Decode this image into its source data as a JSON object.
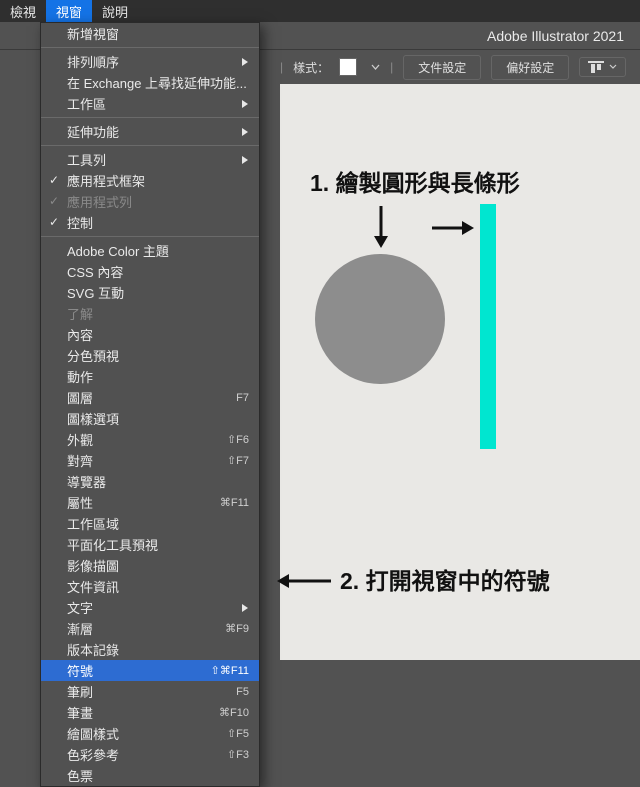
{
  "app_title": "Adobe Illustrator 2021",
  "menubar": {
    "items": [
      {
        "label": "檢視"
      },
      {
        "label": "視窗"
      },
      {
        "label": "說明"
      }
    ]
  },
  "controlbar": {
    "style_label": "樣式：",
    "file_setup": "文件設定",
    "pref_setup": "偏好設定"
  },
  "annotations": {
    "step1": "1.  繪製圓形與長條形",
    "step2": "2.  打開視窗中的符號"
  },
  "window_menu": [
    {
      "label": "新增視窗",
      "type": "item"
    },
    {
      "type": "sep"
    },
    {
      "label": "排列順序",
      "type": "sub"
    },
    {
      "label": "在 Exchange 上尋找延伸功能...",
      "type": "item"
    },
    {
      "label": "工作區",
      "type": "sub"
    },
    {
      "type": "sep"
    },
    {
      "label": "延伸功能",
      "type": "sub"
    },
    {
      "type": "sep"
    },
    {
      "label": "工具列",
      "type": "sub"
    },
    {
      "label": "應用程式框架",
      "type": "check",
      "checked": true
    },
    {
      "label": "應用程式列",
      "type": "check",
      "checked": true,
      "disabled": true
    },
    {
      "label": "控制",
      "type": "check",
      "checked": true
    },
    {
      "type": "sep"
    },
    {
      "label": "Adobe Color 主題",
      "type": "item"
    },
    {
      "label": "CSS 內容",
      "type": "item"
    },
    {
      "label": "SVG 互動",
      "type": "item"
    },
    {
      "label": "了解",
      "type": "item",
      "disabled": true
    },
    {
      "label": "內容",
      "type": "item"
    },
    {
      "label": "分色預視",
      "type": "item"
    },
    {
      "label": "動作",
      "type": "item"
    },
    {
      "label": "圖層",
      "type": "item",
      "shortcut": "F7"
    },
    {
      "label": "圖樣選項",
      "type": "item"
    },
    {
      "label": "外觀",
      "type": "item",
      "shortcut": "⇧F6"
    },
    {
      "label": "對齊",
      "type": "item",
      "shortcut": "⇧F7"
    },
    {
      "label": "導覽器",
      "type": "item"
    },
    {
      "label": "屬性",
      "type": "item",
      "shortcut": "⌘F11"
    },
    {
      "label": "工作區域",
      "type": "item"
    },
    {
      "label": "平面化工具預視",
      "type": "item"
    },
    {
      "label": "影像描圖",
      "type": "item"
    },
    {
      "label": "文件資訊",
      "type": "item"
    },
    {
      "label": "文字",
      "type": "sub"
    },
    {
      "label": "漸層",
      "type": "item",
      "shortcut": "⌘F9"
    },
    {
      "label": "版本記錄",
      "type": "item"
    },
    {
      "label": "符號",
      "type": "item",
      "shortcut": "⇧⌘F11",
      "highlight": true
    },
    {
      "label": "筆刷",
      "type": "item",
      "shortcut": "F5"
    },
    {
      "label": "筆畫",
      "type": "item",
      "shortcut": "⌘F10"
    },
    {
      "label": "繪圖樣式",
      "type": "item",
      "shortcut": "⇧F5"
    },
    {
      "label": "色彩參考",
      "type": "item",
      "shortcut": "⇧F3"
    },
    {
      "label": "色票",
      "type": "item"
    }
  ]
}
